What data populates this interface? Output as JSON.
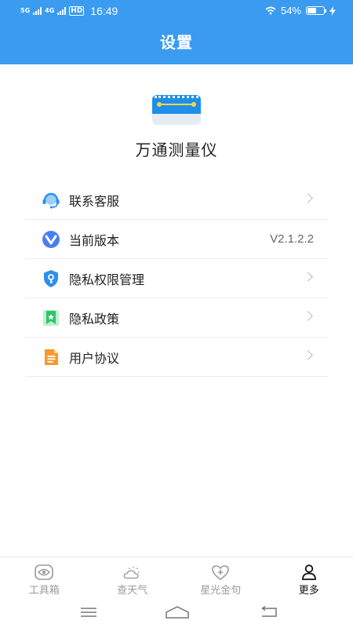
{
  "status_bar": {
    "signal1_label": "5G",
    "signal2_label": "4G",
    "hd_label": "HD",
    "time": "16:49",
    "battery_percent": "54%",
    "battery_level": 0.54
  },
  "header": {
    "title": "设置"
  },
  "app": {
    "name": "万通测量仪",
    "logo_icon": "ruler-icon"
  },
  "menu": [
    {
      "label": "联系客服",
      "icon": "headset-icon"
    },
    {
      "label": "当前版本",
      "icon": "version-icon",
      "value": "V2.1.2.2"
    },
    {
      "label": "隐私权限管理",
      "icon": "shield-key-icon"
    },
    {
      "label": "隐私政策",
      "icon": "bookmark-icon"
    },
    {
      "label": "用户协议",
      "icon": "document-icon"
    }
  ],
  "tabs": [
    {
      "label": "工具箱",
      "icon": "eye-icon"
    },
    {
      "label": "查天气",
      "icon": "weather-icon"
    },
    {
      "label": "星光金句",
      "icon": "heart-icon"
    },
    {
      "label": "更多",
      "icon": "user-icon",
      "active": true
    }
  ],
  "colors": {
    "primary": "#3a9bf1",
    "tab_active": "#111111",
    "tab_inactive": "#9a9a9a"
  }
}
